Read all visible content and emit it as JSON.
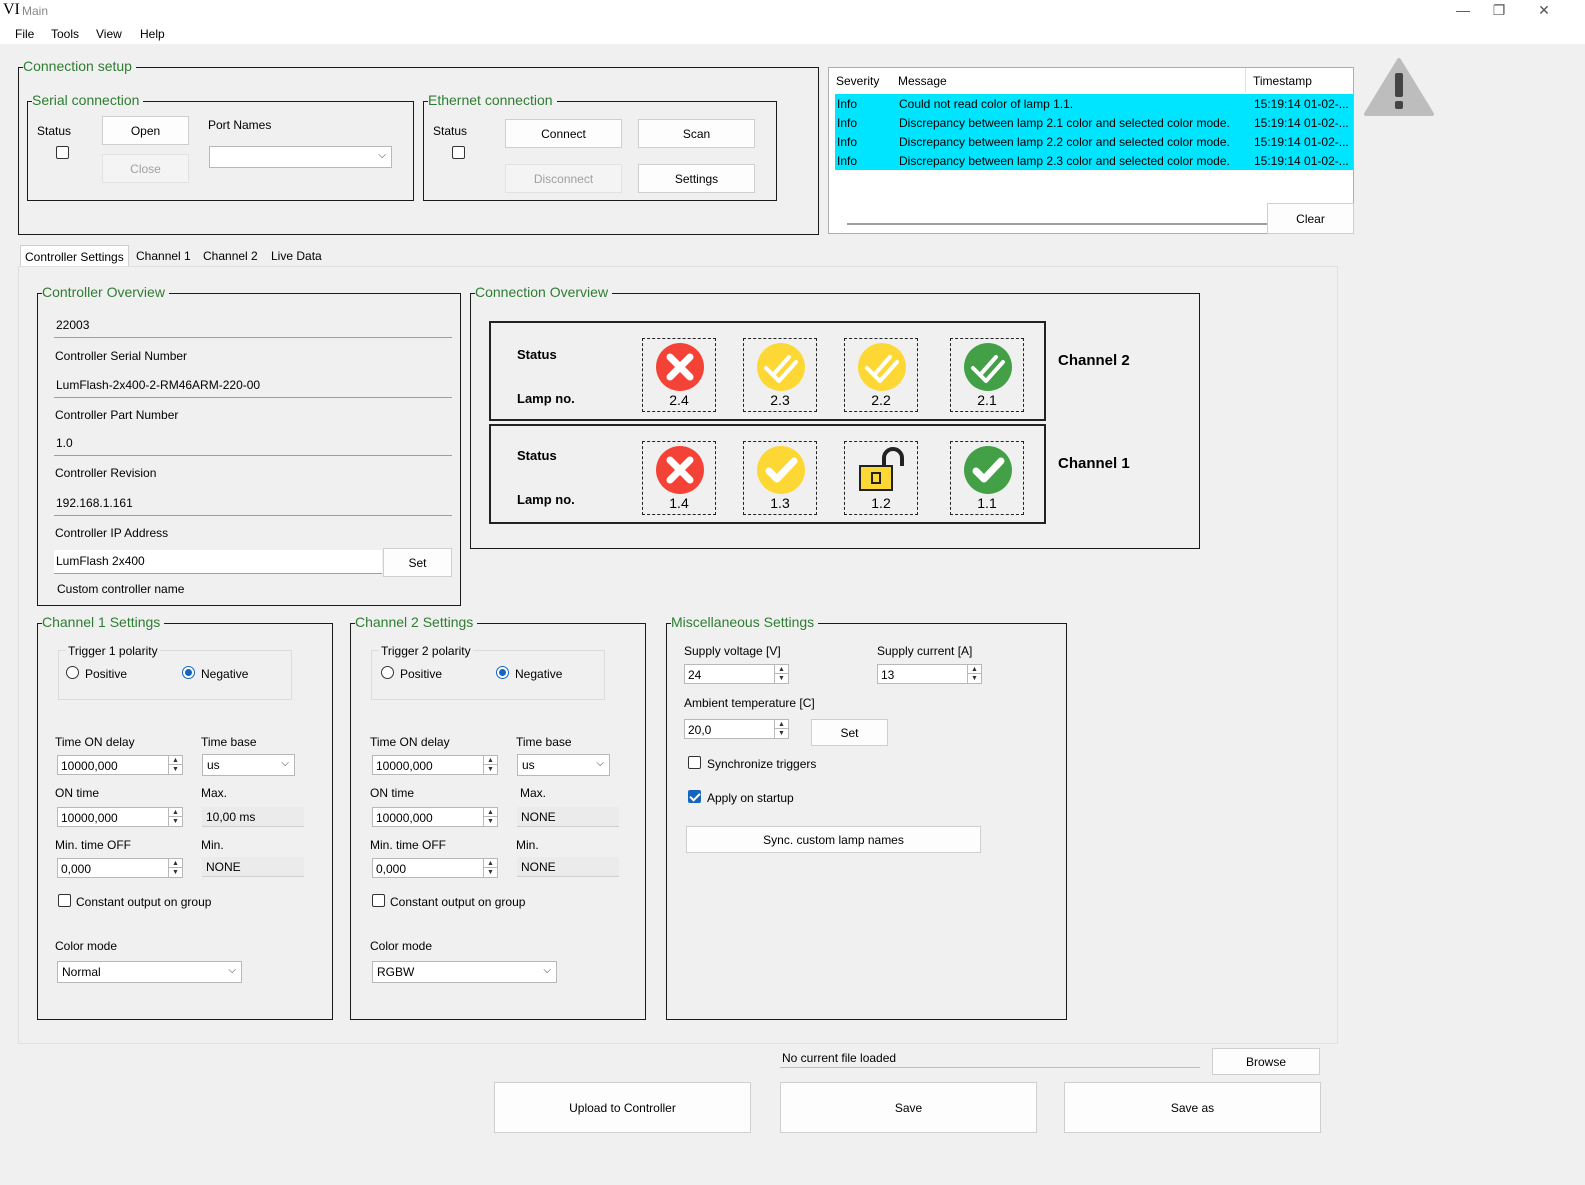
{
  "window": {
    "app_glyph": "VI",
    "title": "Main",
    "minimize": "—",
    "maximize": "❐",
    "close": "✕"
  },
  "menu": [
    "File",
    "Tools",
    "View",
    "Help"
  ],
  "connection_setup": {
    "title": "Connection setup",
    "serial": {
      "title": "Serial connection",
      "status_label": "Status",
      "open": "Open",
      "close": "Close",
      "port_names_label": "Port Names",
      "port_value": ""
    },
    "ethernet": {
      "title": "Ethernet connection",
      "status_label": "Status",
      "connect": "Connect",
      "scan": "Scan",
      "disconnect": "Disconnect",
      "settings": "Settings"
    }
  },
  "log": {
    "headers": [
      "Severity",
      "Message",
      "Timestamp"
    ],
    "rows": [
      {
        "severity": "Info",
        "message": "Could not read color of lamp 1.1.",
        "timestamp": "15:19:14 01-02-..."
      },
      {
        "severity": "Info",
        "message": "Discrepancy between lamp 2.1 color and selected color mode.",
        "timestamp": "15:19:14 01-02-..."
      },
      {
        "severity": "Info",
        "message": "Discrepancy between lamp 2.2 color and selected color mode.",
        "timestamp": "15:19:14 01-02-..."
      },
      {
        "severity": "Info",
        "message": "Discrepancy between lamp 2.3 color and selected color mode.",
        "timestamp": "15:19:14 01-02-..."
      }
    ],
    "clear": "Clear"
  },
  "tabs": [
    "Controller Settings",
    "Channel 1",
    "Channel 2",
    "Live Data"
  ],
  "controller_overview": {
    "title": "Controller Overview",
    "serial_value": "22003",
    "serial_label": "Controller Serial Number",
    "part_value": "LumFlash-2x400-2-RM46ARM-220-00",
    "part_label": "Controller Part Number",
    "revision_value": "1.0",
    "revision_label": "Controller Revision",
    "ip_value": "192.168.1.161",
    "ip_label": "Controller IP Address",
    "name_value": "LumFlash 2x400",
    "set": "Set",
    "name_label": "Custom controller name"
  },
  "connection_overview": {
    "title": "Connection Overview",
    "status_label": "Status",
    "lamp_label": "Lamp no.",
    "channel2": {
      "name": "Channel 2",
      "lamps": [
        "2.4",
        "2.3",
        "2.2",
        "2.1"
      ]
    },
    "channel1": {
      "name": "Channel 1",
      "lamps": [
        "1.4",
        "1.3",
        "1.2",
        "1.1"
      ]
    }
  },
  "channel1_settings": {
    "title": "Channel 1 Settings",
    "trigger_title": "Trigger 1 polarity",
    "positive": "Positive",
    "negative": "Negative",
    "time_on_delay_label": "Time ON delay",
    "time_on_delay": "10000,000",
    "time_base_label": "Time base",
    "time_base": "us",
    "on_time_label": "ON time",
    "on_time": "10000,000",
    "max_label": "Max.",
    "max": "10,00 ms",
    "min_off_label": "Min. time OFF",
    "min_off": "0,000",
    "min_label": "Min.",
    "min": "NONE",
    "constant_output": "Constant output on group",
    "color_mode_label": "Color mode",
    "color_mode": "Normal"
  },
  "channel2_settings": {
    "title": "Channel 2 Settings",
    "trigger_title": "Trigger 2 polarity",
    "positive": "Positive",
    "negative": "Negative",
    "time_on_delay_label": "Time ON delay",
    "time_on_delay": "10000,000",
    "time_base_label": "Time base",
    "time_base": "us",
    "on_time_label": "ON time",
    "on_time": "10000,000",
    "max_label": "Max.",
    "max": "NONE",
    "min_off_label": "Min. time OFF",
    "min_off": "0,000",
    "min_label": "Min.",
    "min": "NONE",
    "constant_output": "Constant output on group",
    "color_mode_label": "Color mode",
    "color_mode": "RGBW"
  },
  "misc_settings": {
    "title": "Miscellaneous Settings",
    "supply_voltage_label": "Supply voltage [V]",
    "supply_voltage": "24",
    "supply_current_label": "Supply current [A]",
    "supply_current": "13",
    "ambient_label": "Ambient temperature [C]",
    "ambient": "20,0",
    "set": "Set",
    "sync_triggers": "Synchronize triggers",
    "apply_startup": "Apply on startup",
    "sync_names": "Sync. custom lamp names"
  },
  "file": {
    "status": "No current file loaded",
    "browse": "Browse",
    "upload": "Upload to Controller",
    "save": "Save",
    "save_as": "Save as"
  },
  "icons": {
    "warning": "warning-icon",
    "error": "error-x-icon",
    "check": "check-icon",
    "lock": "unlocked-lock-icon"
  },
  "colors": {
    "accent_text": "#2e7d32",
    "log_highlight": "#00e5ff",
    "error": "#f44336",
    "warning": "#fdd835",
    "ok": "#43a047"
  }
}
